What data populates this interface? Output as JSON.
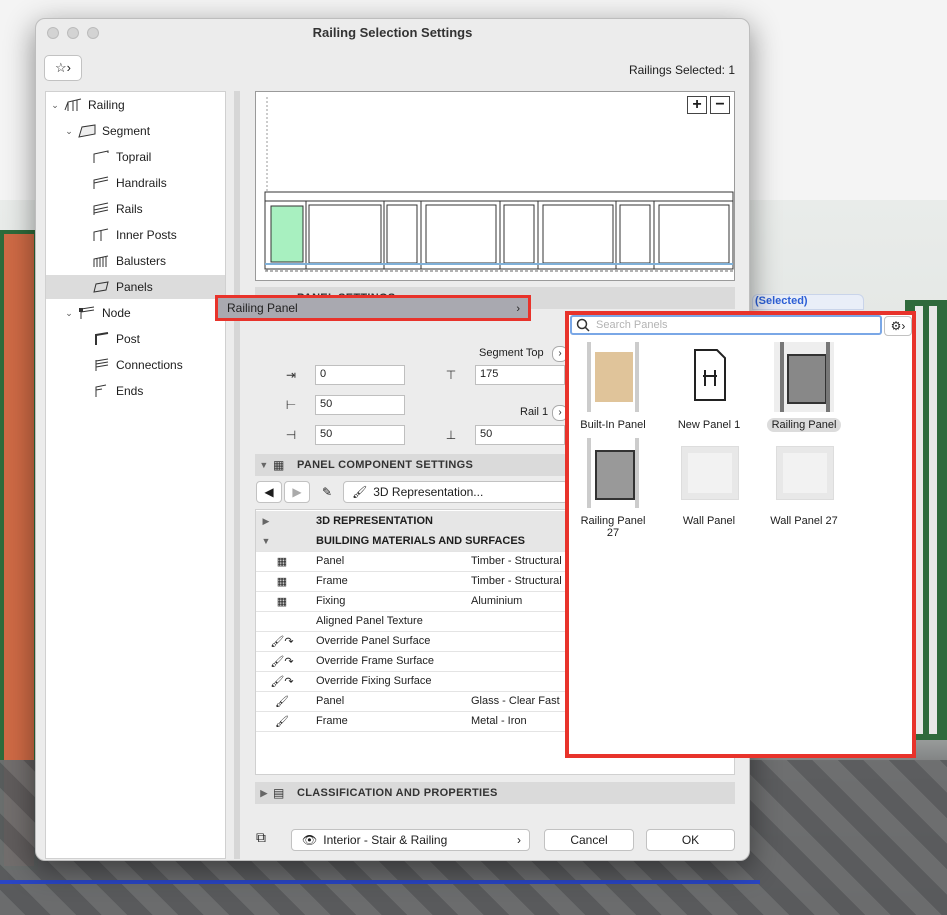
{
  "window": {
    "title": "Railing Selection Settings",
    "selection_count": "Railings Selected: 1"
  },
  "tree": [
    {
      "label": "Railing",
      "level": 0,
      "expanded": true
    },
    {
      "label": "Segment",
      "level": 1,
      "expanded": true
    },
    {
      "label": "Toprail",
      "level": 2
    },
    {
      "label": "Handrails",
      "level": 2
    },
    {
      "label": "Rails",
      "level": 2
    },
    {
      "label": "Inner Posts",
      "level": 2
    },
    {
      "label": "Balusters",
      "level": 2
    },
    {
      "label": "Panels",
      "level": 2,
      "selected": true
    },
    {
      "label": "Node",
      "level": 1,
      "expanded": true
    },
    {
      "label": "Post",
      "level": 2
    },
    {
      "label": "Connections",
      "level": 2
    },
    {
      "label": "Ends",
      "level": 2
    }
  ],
  "preview": {
    "zoom_in": "+",
    "zoom_out": "−"
  },
  "panel_settings": {
    "header": "PANEL SETTINGS",
    "panel_type_label": "Railing Panel",
    "segment_top_label": "Segment Top",
    "rail_label": "Rail 1",
    "fields": {
      "offset_top": "0",
      "segment_top": "175",
      "left_offset": "50",
      "right_offset": "50",
      "rail_offset": "50"
    }
  },
  "component_settings": {
    "header": "PANEL COMPONENT SETTINGS",
    "representation_button": "3D Representation...",
    "groups": [
      {
        "label": "3D REPRESENTATION",
        "expanded": false
      },
      {
        "label": "BUILDING MATERIALS AND SURFACES",
        "expanded": true
      }
    ],
    "rows": [
      {
        "name": "Panel",
        "value": "Timber - Structural",
        "icon": "material-icon"
      },
      {
        "name": "Frame",
        "value": "Timber - Structural",
        "icon": "material-icon"
      },
      {
        "name": "Fixing",
        "value": "Aluminium",
        "icon": "material-icon"
      },
      {
        "name": "Aligned Panel Texture",
        "value": "",
        "icon": ""
      },
      {
        "name": "Override Panel Surface",
        "value": "",
        "icon": "override-icon"
      },
      {
        "name": "Override Frame Surface",
        "value": "",
        "icon": "override-icon"
      },
      {
        "name": "Override Fixing Surface",
        "value": "",
        "icon": "override-icon"
      },
      {
        "name": "Panel",
        "value": "Glass - Clear Fast",
        "icon": "surface-icon"
      },
      {
        "name": "Frame",
        "value": "Metal - Iron",
        "icon": "surface-icon"
      }
    ]
  },
  "classification": {
    "header": "CLASSIFICATION AND PROPERTIES"
  },
  "footer": {
    "layer": "Interior - Stair & Railing",
    "cancel": "Cancel",
    "ok": "OK"
  },
  "picker": {
    "search_placeholder": "Search Panels",
    "selected_tab": "(Selected)",
    "items": [
      {
        "label": "Built-In Panel",
        "selected": false
      },
      {
        "label": "New Panel 1",
        "selected": false
      },
      {
        "label": "Railing Panel",
        "selected": true
      },
      {
        "label": "Railing Panel 27",
        "selected": false
      },
      {
        "label": "Wall Panel",
        "selected": false
      },
      {
        "label": "Wall Panel 27",
        "selected": false
      }
    ]
  },
  "colors": {
    "highlight": "#e8332b",
    "selected_text": "#2c5fd6",
    "panel_fill": "#a8f0c0"
  }
}
